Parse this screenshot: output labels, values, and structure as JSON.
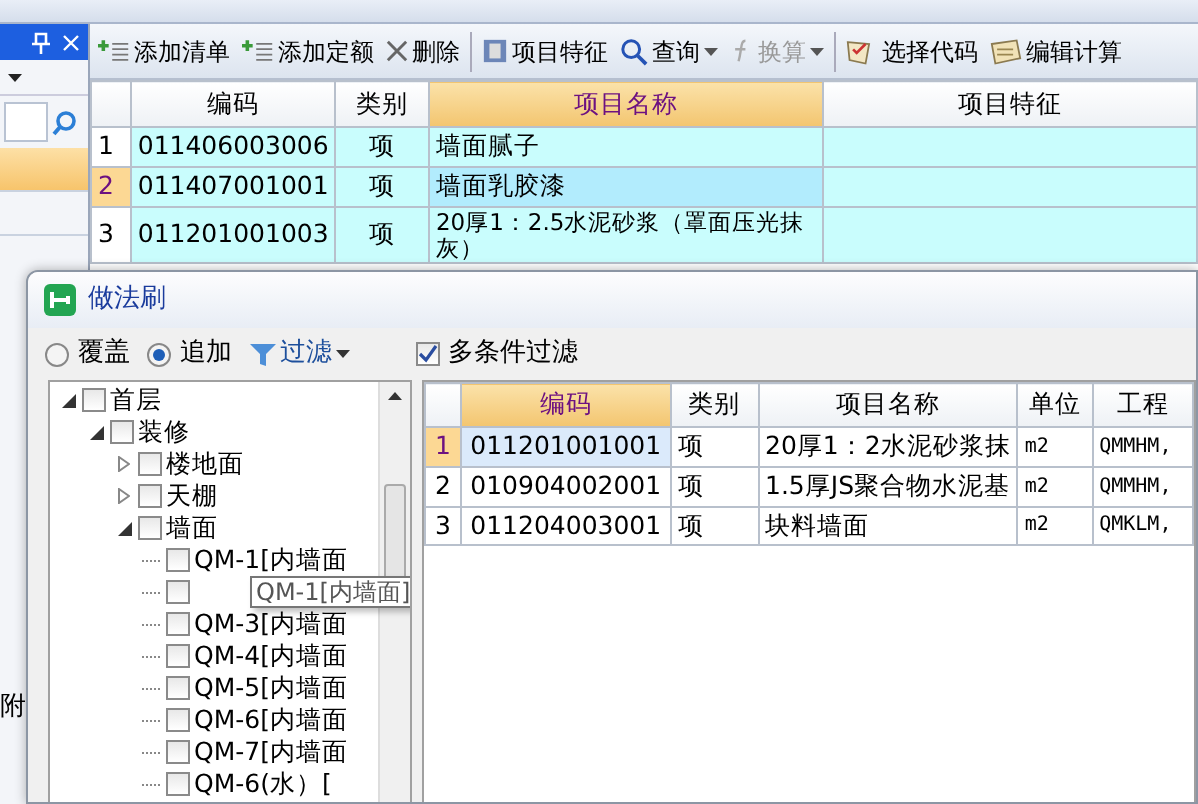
{
  "side_panel": {
    "rows": [
      {
        "selected": true
      },
      {
        "selected": false
      }
    ],
    "footer_text": "附"
  },
  "toolbar": {
    "items": [
      {
        "kind": "add",
        "label": "添加清单",
        "dropdown": false,
        "disabled": false
      },
      {
        "kind": "add",
        "label": "添加定额",
        "dropdown": false,
        "disabled": false
      },
      {
        "kind": "delete",
        "label": "删除",
        "dropdown": false,
        "disabled": false
      },
      {
        "kind": "feature",
        "label": "项目特征",
        "dropdown": false,
        "disabled": false
      },
      {
        "kind": "search",
        "label": "查询",
        "dropdown": true,
        "disabled": false
      },
      {
        "kind": "formula",
        "label": "换算",
        "dropdown": true,
        "disabled": true
      },
      {
        "kind": "code",
        "label": "选择代码",
        "dropdown": false,
        "disabled": false
      },
      {
        "kind": "calc",
        "label": "编辑计算",
        "dropdown": false,
        "disabled": false
      }
    ]
  },
  "table": {
    "columns": [
      "编码",
      "类别",
      "项目名称",
      "项目特征"
    ],
    "rows": [
      {
        "index": "1",
        "code": "011406003006",
        "type": "项",
        "name": "墙面腻子",
        "feature": "",
        "selected": false
      },
      {
        "index": "2",
        "code": "011407001001",
        "type": "项",
        "name": "墙面乳胶漆",
        "feature": "",
        "selected": true
      },
      {
        "index": "3",
        "code": "011201001003",
        "type": "项",
        "name": "20厚1：2.5水泥砂浆（罩面压光抹灰）",
        "feature": "",
        "selected": false
      }
    ]
  },
  "dialog": {
    "title": "做法刷",
    "modes": [
      {
        "label": "覆盖",
        "selected": false
      },
      {
        "label": "追加",
        "selected": true
      }
    ],
    "filter_button": "过滤",
    "multi_filter": {
      "label": "多条件过滤",
      "checked": true
    },
    "tree": [
      {
        "label": "首层",
        "expanded": true,
        "checked": false,
        "children": [
          {
            "label": "装修",
            "expanded": true,
            "checked": false,
            "children": [
              {
                "label": "楼地面",
                "expanded": false,
                "checked": false
              },
              {
                "label": "天棚",
                "expanded": false,
                "checked": false
              },
              {
                "label": "墙面",
                "expanded": true,
                "checked": false,
                "children": [
                  {
                    "label": "QM-1[内墙面",
                    "checked": false
                  },
                  {
                    "checked": false
                  },
                  {
                    "label": "QM-3[内墙面",
                    "checked": false
                  },
                  {
                    "label": "QM-4[内墙面",
                    "checked": false
                  },
                  {
                    "label": "QM-5[内墙面",
                    "checked": false
                  },
                  {
                    "label": "QM-6[内墙面",
                    "checked": false
                  },
                  {
                    "label": "QM-7[内墙面",
                    "checked": false
                  },
                  {
                    "label": "QM-6(水）[",
                    "checked": false
                  }
                ]
              }
            ]
          }
        ]
      }
    ],
    "tooltip": "QM-1[内墙面]",
    "table": {
      "columns": [
        "编码",
        "类别",
        "项目名称",
        "单位",
        "工程"
      ],
      "rows": [
        {
          "index": "1",
          "code": "011201001001",
          "type": "项",
          "name": "20厚1：2水泥砂浆抹",
          "unit": "m2",
          "column_5": "QMMHM,",
          "selected": true
        },
        {
          "index": "2",
          "code": "010904002001",
          "type": "项",
          "name": "1.5厚JS聚合物水泥基",
          "unit": "m2",
          "column_5": "QMMHM,",
          "selected": false
        },
        {
          "index": "3",
          "code": "011204003001",
          "type": "项",
          "name": "块料墙面",
          "unit": "m2",
          "column_5": "QMKLM,",
          "selected": false
        }
      ]
    }
  }
}
